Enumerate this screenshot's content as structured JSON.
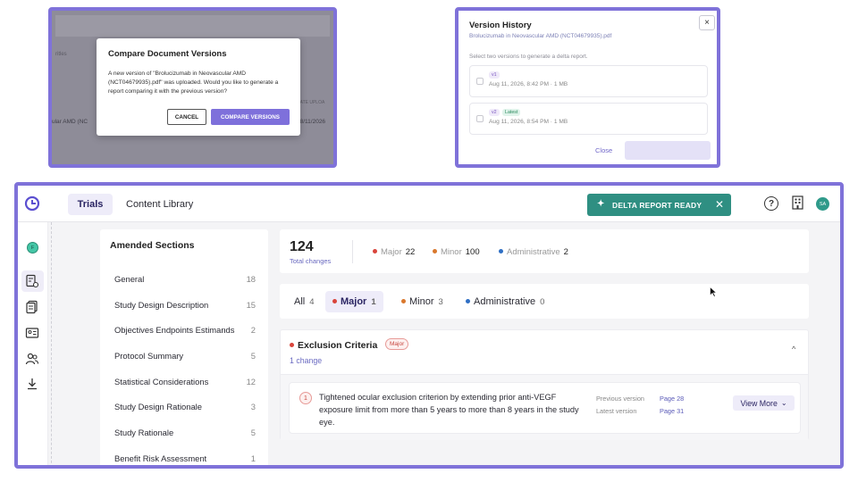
{
  "compare_dialog": {
    "background_labels": [
      "ritles",
      "ular AMD (NC",
      "DATE UPLOA",
      "08/11/2026"
    ],
    "title": "Compare Document Versions",
    "message": "A new version of \"Brolucizumab in Neovascular AMD (NCT04679935).pdf\" was uploaded. Would you like to generate a report comparing it with the previous version?",
    "cancel_label": "CANCEL",
    "compare_label": "COMPARE VERSIONS"
  },
  "version_history": {
    "title": "Version History",
    "subtitle": "Brolucizumab in Neovascular AMD (NCT04679935).pdf",
    "close_icon": "×",
    "hint": "Select two versions to generate a delta report.",
    "versions": [
      {
        "tag": "v1",
        "latest": "",
        "date": "Aug 11, 2026, 8:42 PM · 1 MB"
      },
      {
        "tag": "v2",
        "latest": "Latest",
        "date": "Aug 11, 2026, 8:54 PM · 1 MB"
      }
    ],
    "close_label": "Close"
  },
  "app": {
    "nav": {
      "trials": "Trials",
      "content_library": "Content Library"
    },
    "delta_banner": {
      "label": "DELTA REPORT READY",
      "spark": "✦",
      "close": "✕"
    },
    "help": "?",
    "user_initials": "SA",
    "rail_avatar": "F",
    "sections_panel": {
      "title": "Amended Sections",
      "items": [
        {
          "name": "General",
          "count": "18"
        },
        {
          "name": "Study Design Description",
          "count": "15"
        },
        {
          "name": "Objectives Endpoints Estimands",
          "count": "2"
        },
        {
          "name": "Protocol Summary",
          "count": "5"
        },
        {
          "name": "Statistical Considerations",
          "count": "12"
        },
        {
          "name": "Study Design Rationale",
          "count": "3"
        },
        {
          "name": "Study Rationale",
          "count": "5"
        },
        {
          "name": "Benefit Risk Assessment",
          "count": "1"
        }
      ]
    },
    "stats": {
      "total": "124",
      "total_label": "Total changes",
      "major_label": "Major",
      "major": "22",
      "minor_label": "Minor",
      "minor": "100",
      "admin_label": "Administrative",
      "admin": "2"
    },
    "tabs": [
      {
        "label": "All",
        "count": "4"
      },
      {
        "label": "Major",
        "count": "1"
      },
      {
        "label": "Minor",
        "count": "3"
      },
      {
        "label": "Administrative",
        "count": "0"
      }
    ],
    "exclusion": {
      "title": "Exclusion Criteria",
      "badge": "Major",
      "changes": "1 change",
      "chevron": "^",
      "change": {
        "num": "1",
        "text": "Tightened ocular exclusion criterion by extending prior anti-VEGF exposure limit from more than 5 years to more than 8 years in the study eye.",
        "prev_label": "Previous version",
        "prev_page": "Page 28",
        "latest_label": "Latest version",
        "latest_page": "Page 31",
        "view_more": "View More",
        "view_more_chevron": "⌄"
      }
    }
  },
  "colors": {
    "accent": "#7e70db",
    "frame": "#7f72d9",
    "teal": "#2f8f82",
    "major": "#d9443b",
    "minor": "#d9782d",
    "admin": "#2f6fc4"
  }
}
